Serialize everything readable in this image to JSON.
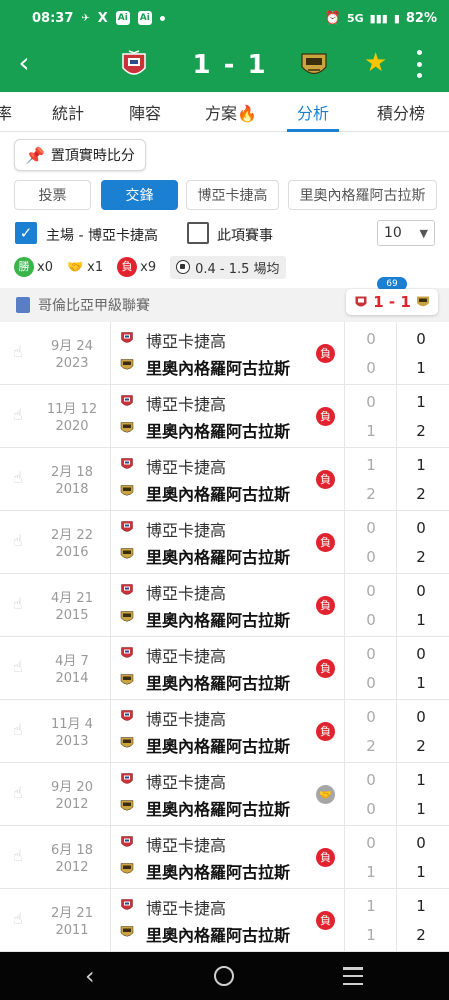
{
  "status_bar": {
    "time": "08:37",
    "network": "5G",
    "battery": "82%",
    "app_icon_1": "Ai",
    "app_icon_2": "Ai"
  },
  "header": {
    "score": "1 - 1",
    "home_crest": "shield-crest-icon",
    "away_crest": "gold-crest-icon"
  },
  "tabs": [
    {
      "label": "率"
    },
    {
      "label": "統計"
    },
    {
      "label": "陣容"
    },
    {
      "label": "方案🔥"
    },
    {
      "label": "分析"
    },
    {
      "label": "積分榜"
    }
  ],
  "active_tab": "分析",
  "pin_button": "置頂實時比分",
  "segments": [
    {
      "label": "投票"
    },
    {
      "label": "交鋒"
    },
    {
      "label": "博亞卡捷高"
    },
    {
      "label": "里奧內格羅阿古拉斯"
    }
  ],
  "active_segment": "交鋒",
  "filters": {
    "home_filter": "主場 - 博亞卡捷高",
    "home_checked": true,
    "same_event": "此項賽事",
    "same_event_checked": false,
    "count": "10"
  },
  "summary": {
    "win_badge": "勝",
    "win_count": "x0",
    "draw_count": "x1",
    "loss_badge": "負",
    "loss_count": "x9",
    "over_under": "0.4 - 1.5 場均"
  },
  "league": {
    "name": "哥倫比亞甲級聯賽",
    "live_minute": "69",
    "live_score": "1 - 1"
  },
  "matches": [
    {
      "date": "9月 24",
      "year": "2023",
      "home": "博亞卡捷高",
      "away": "里奧內格羅阿古拉斯",
      "result": "負",
      "result_type": "loss",
      "ht_home": "0",
      "ht_away": "0",
      "ft_home": "0",
      "ft_away": "1"
    },
    {
      "date": "11月 12",
      "year": "2020",
      "home": "博亞卡捷高",
      "away": "里奧內格羅阿古拉斯",
      "result": "負",
      "result_type": "loss",
      "ht_home": "0",
      "ht_away": "1",
      "ft_home": "1",
      "ft_away": "2"
    },
    {
      "date": "2月 18",
      "year": "2018",
      "home": "博亞卡捷高",
      "away": "里奧內格羅阿古拉斯",
      "result": "負",
      "result_type": "loss",
      "ht_home": "1",
      "ht_away": "2",
      "ft_home": "1",
      "ft_away": "2"
    },
    {
      "date": "2月 22",
      "year": "2016",
      "home": "博亞卡捷高",
      "away": "里奧內格羅阿古拉斯",
      "result": "負",
      "result_type": "loss",
      "ht_home": "0",
      "ht_away": "0",
      "ft_home": "0",
      "ft_away": "2"
    },
    {
      "date": "4月 21",
      "year": "2015",
      "home": "博亞卡捷高",
      "away": "里奧內格羅阿古拉斯",
      "result": "負",
      "result_type": "loss",
      "ht_home": "0",
      "ht_away": "0",
      "ft_home": "0",
      "ft_away": "1"
    },
    {
      "date": "4月 7",
      "year": "2014",
      "home": "博亞卡捷高",
      "away": "里奧內格羅阿古拉斯",
      "result": "負",
      "result_type": "loss",
      "ht_home": "0",
      "ht_away": "0",
      "ft_home": "0",
      "ft_away": "1"
    },
    {
      "date": "11月 4",
      "year": "2013",
      "home": "博亞卡捷高",
      "away": "里奧內格羅阿古拉斯",
      "result": "負",
      "result_type": "loss",
      "ht_home": "0",
      "ht_away": "2",
      "ft_home": "0",
      "ft_away": "2"
    },
    {
      "date": "9月 20",
      "year": "2012",
      "home": "博亞卡捷高",
      "away": "里奧內格羅阿古拉斯",
      "result": "",
      "result_type": "draw",
      "ht_home": "0",
      "ht_away": "0",
      "ft_home": "1",
      "ft_away": "1"
    },
    {
      "date": "6月 18",
      "year": "2012",
      "home": "博亞卡捷高",
      "away": "里奧內格羅阿古拉斯",
      "result": "負",
      "result_type": "loss",
      "ht_home": "0",
      "ht_away": "1",
      "ft_home": "0",
      "ft_away": "1"
    },
    {
      "date": "2月 21",
      "year": "2011",
      "home": "博亞卡捷高",
      "away": "里奧內格羅阿古拉斯",
      "result": "負",
      "result_type": "loss",
      "ht_home": "1",
      "ht_away": "1",
      "ft_home": "1",
      "ft_away": "2"
    }
  ],
  "colors": {
    "brand_green": "#17a052",
    "accent_blue": "#1b7fd2",
    "loss_red": "#e0232e",
    "win_green": "#3bb54a",
    "draw_gray": "#a6a6a6"
  }
}
